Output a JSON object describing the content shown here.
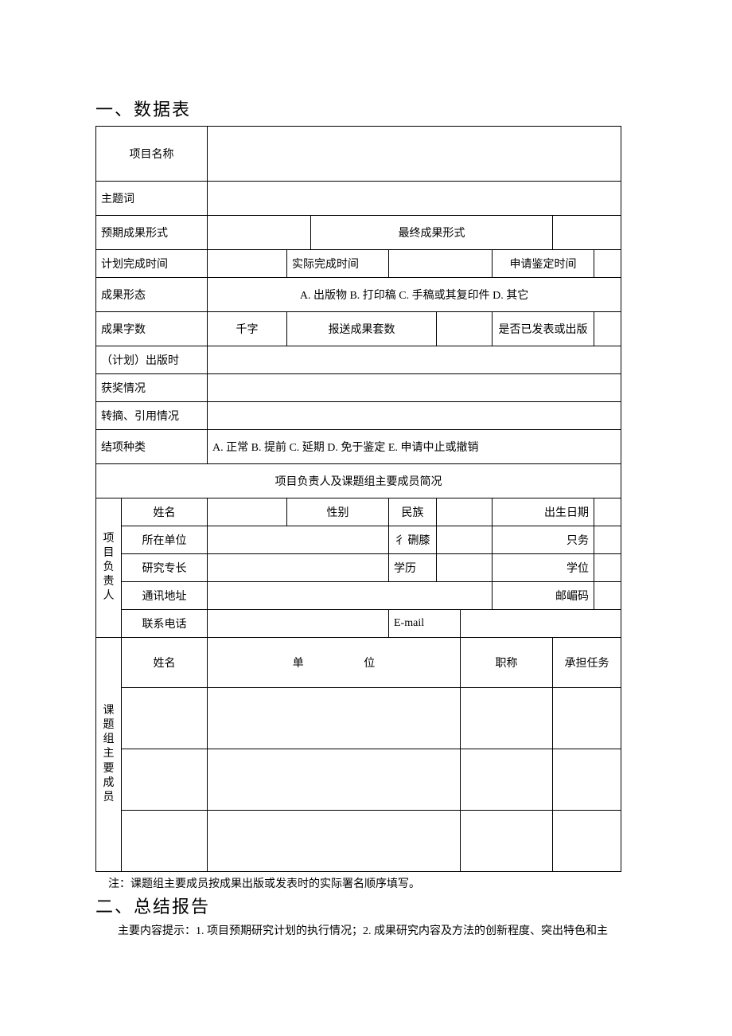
{
  "section1_title": "一、数据表",
  "section2_title": "二、总结报告",
  "labels": {
    "project_name": "项目名称",
    "keywords": "主题词",
    "expected_form": "预期成果形式",
    "final_form": "最终成果形式",
    "plan_finish": "计划完成时间",
    "actual_finish": "实际完成时间",
    "apply_time": "申请鉴定时间",
    "result_state": "成果形态",
    "result_state_opts": "A. 出版物 B. 打印稿 C. 手稿或其复印件 D. 其它",
    "word_count": "成果字数",
    "qianzi": "千字",
    "sets": "报送成果套数",
    "published_q": "是否已发表或出版",
    "plan_pub": "（计划）出版时",
    "awards": "获奖情况",
    "excerpt": "转摘、引用情况",
    "close_type": "结项种类",
    "close_type_opts": "A. 正常 B. 提前 C. 延期 D. 免于鉴定 E. 申请中止或撤销",
    "team_header": "项目负责人及课题组主要成员简况",
    "leader": "项目负责人",
    "name": "姓名",
    "sex": "性别",
    "nation": "民族",
    "birth": "出生日期",
    "org": "所在单位",
    "title_row2a": "彳 硎膝",
    "title_row2b": "只务",
    "spec": "研究专长",
    "edu": "学历",
    "degree": "学位",
    "addr": "通讯地址",
    "postcode": "邮嵋码",
    "tel": "联系电话",
    "email": "E-mail",
    "members": "课 题 组 主 要 成 员",
    "m_name": "姓名",
    "m_unit": "单    位",
    "m_title": "职称",
    "m_task": "承担任务"
  },
  "note": "注：课题组主要成员按成果出版或发表时的实际署名顺序填写。",
  "intro": "主要内容提示：1. 项目预期研究计划的执行情况；2. 成果研究内容及方法的创新程度、突出特色和主"
}
